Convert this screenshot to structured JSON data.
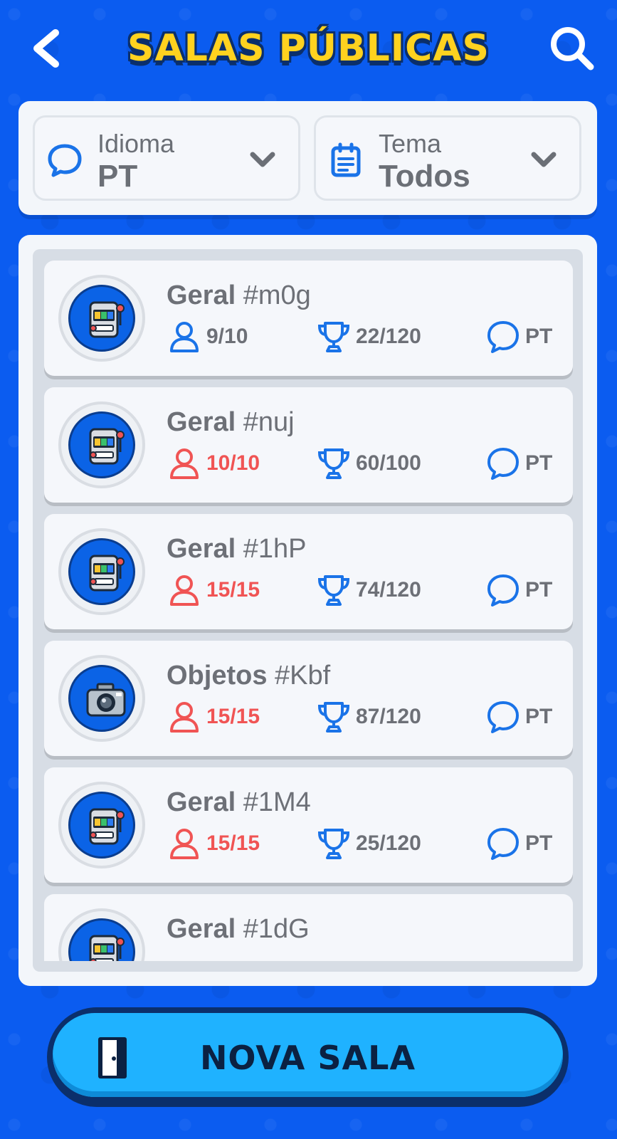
{
  "header": {
    "title": "SALAS PÚBLICAS"
  },
  "filters": {
    "language": {
      "label": "Idioma",
      "value": "PT"
    },
    "theme": {
      "label": "Tema",
      "value": "Todos"
    }
  },
  "rooms": [
    {
      "category": "Geral",
      "code": "#m0g",
      "players": "9/10",
      "players_full": false,
      "score": "22/120",
      "lang": "PT",
      "icon": "slot-machine-icon"
    },
    {
      "category": "Geral",
      "code": "#nuj",
      "players": "10/10",
      "players_full": true,
      "score": "60/100",
      "lang": "PT",
      "icon": "slot-machine-icon"
    },
    {
      "category": "Geral",
      "code": "#1hP",
      "players": "15/15",
      "players_full": true,
      "score": "74/120",
      "lang": "PT",
      "icon": "slot-machine-icon"
    },
    {
      "category": "Objetos",
      "code": "#Kbf",
      "players": "15/15",
      "players_full": true,
      "score": "87/120",
      "lang": "PT",
      "icon": "camera-icon"
    },
    {
      "category": "Geral",
      "code": "#1M4",
      "players": "15/15",
      "players_full": true,
      "score": "25/120",
      "lang": "PT",
      "icon": "slot-machine-icon"
    },
    {
      "category": "Geral",
      "code": "#1dG",
      "icon": "slot-machine-icon"
    }
  ],
  "new_room": {
    "label": "NOVA SALA"
  },
  "colors": {
    "background": "#0b5cf0",
    "accent_blue": "#1a73e8",
    "full_red": "#f05454",
    "title_yellow": "#ffd21f",
    "button_cyan": "#1fb2ff"
  }
}
